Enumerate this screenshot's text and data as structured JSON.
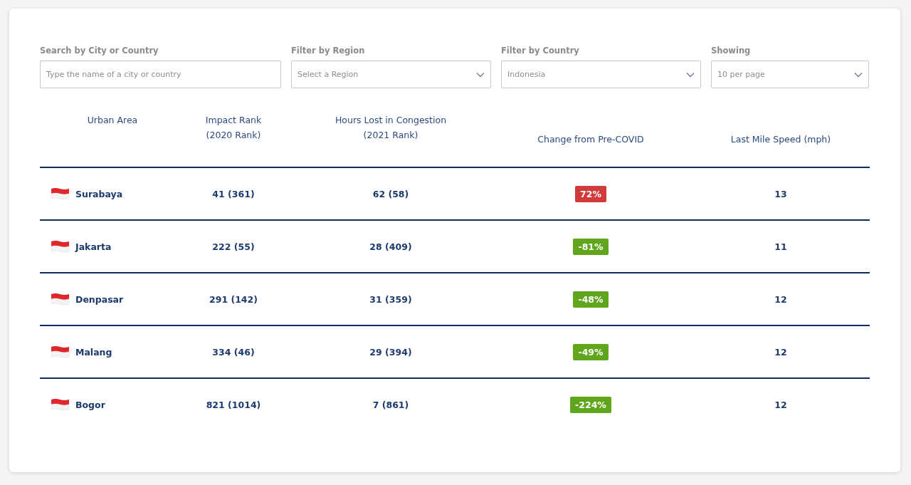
{
  "filters": [
    {
      "kind": "search",
      "label": "Search by City or Country",
      "placeholder": "Type the name of a city or country"
    },
    {
      "kind": "select",
      "label": "Filter by Region",
      "placeholder": "Select a Region"
    },
    {
      "kind": "select",
      "label": "Filter by Country",
      "value": "Indonesia"
    },
    {
      "kind": "select",
      "label": "Showing",
      "value": "10 per page"
    }
  ],
  "table": {
    "columns": [
      "Urban Area",
      "Impact Rank\n(2020 Rank)",
      "Hours Lost in Congestion\n(2021 Rank)",
      "Change from Pre-COVID",
      "Last Mile Speed (mph)"
    ],
    "rows": [
      {
        "urban_area": "Surabaya",
        "impact_rank": "41 (361)",
        "hours_lost": "62 (58)",
        "change": "72%",
        "color": "#d03a3a",
        "speed": "13"
      },
      {
        "urban_area": "Jakarta",
        "impact_rank": "222 (55)",
        "hours_lost": "28 (409)",
        "change": "-81%",
        "color": "#5fa61c",
        "speed": "11"
      },
      {
        "urban_area": "Denpasar",
        "impact_rank": "291 (142)",
        "hours_lost": "31 (359)",
        "change": "-48%",
        "color": "#5fa61c",
        "speed": "12"
      },
      {
        "urban_area": "Malang",
        "impact_rank": "334 (46)",
        "hours_lost": "29 (394)",
        "change": "-49%",
        "color": "#5fa61c",
        "speed": "12"
      },
      {
        "urban_area": "Bogor",
        "impact_rank": "821 (1014)",
        "hours_lost": "7 (861)",
        "change": "-224%",
        "color": "#5fa61c",
        "speed": "12"
      }
    ]
  }
}
